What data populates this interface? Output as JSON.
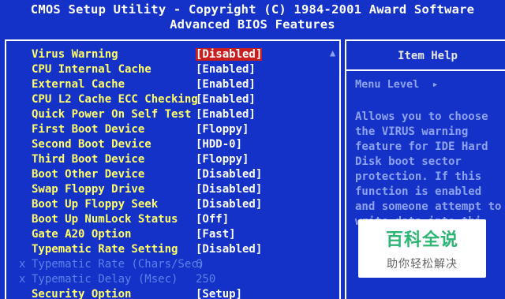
{
  "header": {
    "line1": "CMOS Setup Utility - Copyright (C) 1984-2001 Award Software",
    "line2": "Advanced BIOS Features"
  },
  "settings": [
    {
      "label": "Virus Warning",
      "value": "[Disabled]",
      "selected": true
    },
    {
      "label": "CPU Internal Cache",
      "value": "[Enabled]"
    },
    {
      "label": "External Cache",
      "value": "[Enabled]"
    },
    {
      "label": "CPU L2 Cache ECC Checking",
      "value": "[Enabled]"
    },
    {
      "label": "Quick Power On Self Test",
      "value": "[Enabled]"
    },
    {
      "label": "First Boot Device",
      "value": "[Floppy]"
    },
    {
      "label": "Second Boot Device",
      "value": "[HDD-0]"
    },
    {
      "label": "Third Boot Device",
      "value": "[Floppy]"
    },
    {
      "label": "Boot Other Device",
      "value": "[Disabled]"
    },
    {
      "label": "Swap Floppy Drive",
      "value": "[Disabled]"
    },
    {
      "label": "Boot Up Floppy Seek",
      "value": "[Disabled]"
    },
    {
      "label": "Boot Up NumLock Status",
      "value": "[Off]"
    },
    {
      "label": "Gate A20 Option",
      "value": "[Fast]"
    },
    {
      "label": "Typematic Rate Setting",
      "value": "[Disabled]"
    },
    {
      "label": "Typematic Rate (Chars/Sec)",
      "value": "6",
      "disabled": true,
      "mark": "x"
    },
    {
      "label": "Typematic Delay (Msec)",
      "value": "250",
      "disabled": true,
      "mark": "x"
    },
    {
      "label": "Security Option",
      "value": "[Setup]"
    }
  ],
  "help": {
    "title": "Item Help",
    "menu_level": "Menu Level  ▸",
    "lines": [
      "Allows you to choose",
      "the VIRUS warning",
      "feature for IDE Hard",
      "Disk boot sector",
      "protection. If this",
      "function is enabled",
      "and someone attempt to",
      "write data into thi"
    ]
  },
  "scroll_indicator": "▲",
  "watermark": {
    "title": "百科全说",
    "subtitle": "助你轻松解决"
  },
  "colors": {
    "background": "#1432c8",
    "label": "#ffff66",
    "value": "#ffffff",
    "highlight": "#c81e1e",
    "disabled": "#5a82e6",
    "help_text": "#8da3ef",
    "watermark_green": "#2bb673"
  }
}
